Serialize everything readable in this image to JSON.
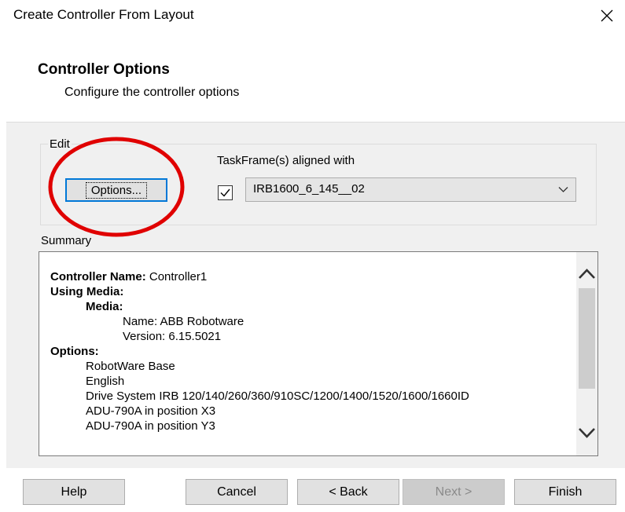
{
  "window": {
    "title": "Create Controller From Layout"
  },
  "header": {
    "title": "Controller Options",
    "subtitle": "Configure the controller options"
  },
  "edit_group": {
    "label": "Edit",
    "options_button_label": "Options...",
    "taskframe_label": "TaskFrame(s) aligned with",
    "taskframe_checked": true,
    "taskframe_value": "IRB1600_6_145__02"
  },
  "summary": {
    "label": "Summary",
    "controller_name_key": "Controller Name:",
    "controller_name_value": " Controller1",
    "using_media_key": "Using Media:",
    "media_key": "Media:",
    "media_name": "Name: ABB Robotware",
    "media_version": "Version: 6.15.5021",
    "options_key": "Options:",
    "options": [
      "RobotWare Base",
      "English",
      "Drive System IRB 120/140/260/360/910SC/1200/1400/1520/1600/1660ID",
      "ADU-790A in position X3",
      "ADU-790A in position Y3"
    ]
  },
  "buttons": {
    "help": "Help",
    "cancel": "Cancel",
    "back": "< Back",
    "next": "Next >",
    "finish": "Finish"
  },
  "colors": {
    "focus_border": "#0078d7",
    "annotation_red": "#e00000"
  }
}
